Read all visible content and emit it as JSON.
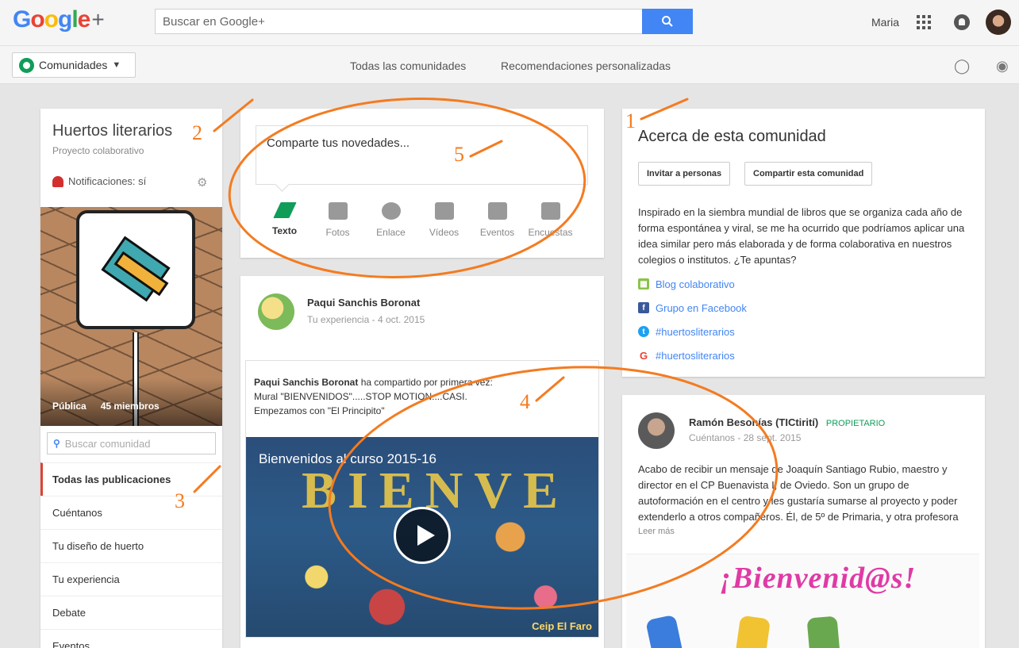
{
  "topbar": {
    "search_placeholder": "Buscar en Google+",
    "user_name": "Maria"
  },
  "subbar": {
    "communities_label": "Comunidades",
    "link_all": "Todas las comunidades",
    "link_recommended": "Recomendaciones personalizadas"
  },
  "community": {
    "title": "Huertos literarios",
    "subtitle": "Proyecto colaborativo",
    "notifications": "Notificaciones: sí",
    "visibility": "Pública",
    "members": "45 miembros",
    "search_placeholder": "Buscar comunidad",
    "categories": [
      "Todas las publicaciones",
      "Cuéntanos",
      "Tu diseño de huerto",
      "Tu experiencia",
      "Debate",
      "Eventos"
    ]
  },
  "share": {
    "prompt": "Comparte tus novedades...",
    "tools": [
      {
        "label": "Texto",
        "icon": "pencil-icon"
      },
      {
        "label": "Fotos",
        "icon": "camera-icon"
      },
      {
        "label": "Enlace",
        "icon": "link-icon"
      },
      {
        "label": "Vídeos",
        "icon": "video-icon"
      },
      {
        "label": "Eventos",
        "icon": "calendar-icon"
      },
      {
        "label": "Encuestas",
        "icon": "poll-icon"
      }
    ]
  },
  "post": {
    "author": "Paqui Sanchis Boronat",
    "category": "Tu experiencia",
    "date": "4 oct. 2015",
    "shared_author": "Paqui Sanchis Boronat",
    "shared_action": "ha compartido por primera vez:",
    "shared_line1": "Mural \"BIENVENIDOS\".....STOP MOTION....CASI.",
    "shared_line2": "Empezamos con \"El Principito\"",
    "video_title": "Bienvenidos al curso 2015-16",
    "video_letters": "BIENVE",
    "video_watermark": "Ceip El Faro"
  },
  "about": {
    "title": "Acerca de esta comunidad",
    "invite_button": "Invitar a personas",
    "share_button": "Compartir esta comunidad",
    "description": "Inspirado en la siembra mundial de libros que se organiza cada año de forma espontánea y viral, se me ha ocurrido que podríamos aplicar una idea similar pero más elaborada y de forma colaborativa en nuestros colegios o institutos. ¿Te apuntas?",
    "links": [
      {
        "label": "Blog colaborativo",
        "icon": "blog-icon"
      },
      {
        "label": "Grupo en Facebook",
        "icon": "facebook-icon"
      },
      {
        "label": "#huertosliterarios",
        "icon": "twitter-icon"
      },
      {
        "label": "#huertosliterarios",
        "icon": "google-icon"
      }
    ]
  },
  "post2": {
    "author": "Ramón Besonías (TICtirití)",
    "badge": "PROPIETARIO",
    "category": "Cuéntanos",
    "date": "28 sept. 2015",
    "text": "Acabo de recibir un mensaje de Joaquín Santiago Rubio, maestro y director en el CP Buenavista I, de Oviedo. Son un grupo de autoformación en el centro y les gustaría sumarse al proyecto y poder extenderlo a otros compañeros. Él, de 5º de Primaria, y otra profesora",
    "read_more": "Leer más",
    "image_text": "¡Bienvenid@s!"
  },
  "annotations": [
    "1",
    "2",
    "3",
    "4",
    "5"
  ],
  "colors": {
    "accent": "#4285f4",
    "annotation": "#f47b20",
    "owner": "#0f9d58",
    "active_indicator": "#db4437"
  }
}
